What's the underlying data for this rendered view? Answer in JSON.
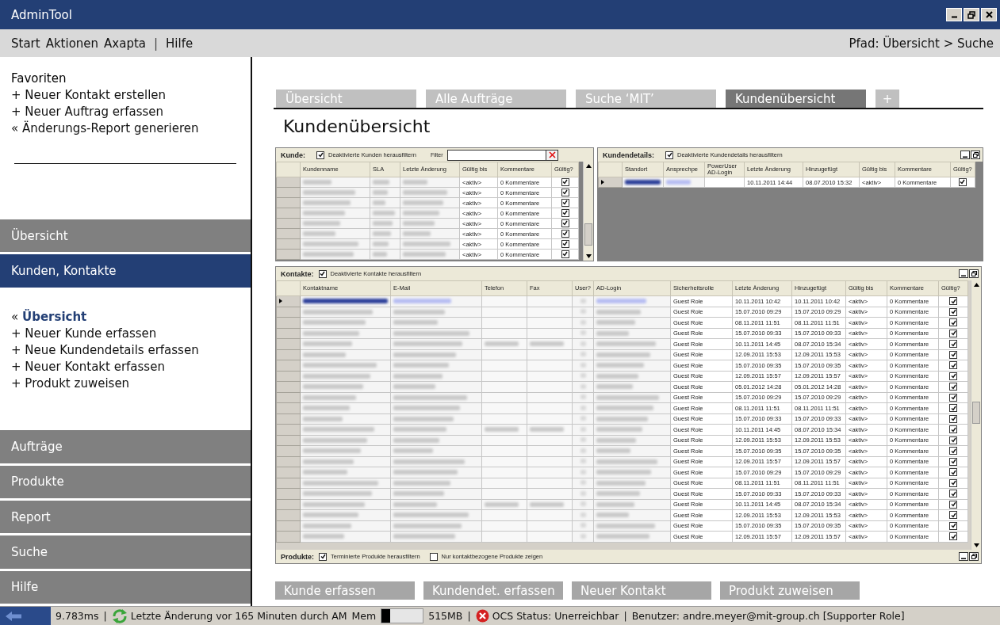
{
  "window": {
    "title": "AdminTool"
  },
  "menu": [
    {
      "kind": "item",
      "label": "Start"
    },
    {
      "kind": "item",
      "label": "Aktionen"
    },
    {
      "kind": "item",
      "label": "Axapta"
    },
    {
      "kind": "sep",
      "label": "|"
    },
    {
      "kind": "item",
      "label": "Hilfe"
    }
  ],
  "path": "Pfad: Übersicht > Suche",
  "favorites": {
    "title": "Favoriten",
    "links": [
      "+ Neuer Kontakt erstellen",
      "+ Neuer Auftrag erfassen",
      "« Änderungs-Report generieren"
    ]
  },
  "nav": [
    {
      "label": "Übersicht",
      "selected": false
    },
    {
      "label": "Kunden, Kontakte",
      "selected": true,
      "children": [
        {
          "prefix": "«",
          "label": "Übersicht",
          "selected": true
        },
        {
          "prefix": "+",
          "label": "Neuer Kunde erfassen",
          "selected": false
        },
        {
          "prefix": "+",
          "label": "Neue Kundendetails erfassen",
          "selected": false
        },
        {
          "prefix": "+",
          "label": "Neuer Kontakt erfassen",
          "selected": false
        },
        {
          "prefix": "+",
          "label": "Produkt zuweisen",
          "selected": false
        }
      ]
    },
    {
      "label": "Aufträge",
      "selected": false
    },
    {
      "label": "Produkte",
      "selected": false
    },
    {
      "label": "Report",
      "selected": false
    },
    {
      "label": "Suche",
      "selected": false
    },
    {
      "label": "Hilfe",
      "selected": false
    }
  ],
  "tabs": [
    {
      "kind": "tab",
      "label": "Übersicht",
      "selected": false
    },
    {
      "kind": "tab",
      "label": "Alle Aufträge",
      "selected": false
    },
    {
      "kind": "tab",
      "label": "Suche ‘MIT’",
      "selected": false
    },
    {
      "kind": "tab",
      "label": "Kundenübersicht",
      "selected": true
    },
    {
      "kind": "add",
      "label": "+",
      "selected": false
    }
  ],
  "heading": "Kundenübersicht",
  "customers": {
    "title": "Kunde:",
    "filter_toggle": {
      "label": "Deaktivierte Kunden herausfiltern",
      "checked": true
    },
    "filter_label": "Filter",
    "columns": [
      {
        "label": "Kundenname",
        "kind": "blur"
      },
      {
        "label": "SLA",
        "kind": "blur"
      },
      {
        "label": "Letzte Änderung",
        "kind": "blur"
      },
      {
        "label": "Gültig bis",
        "kind": "text"
      },
      {
        "label": "Kommentare",
        "kind": "text"
      },
      {
        "label": "Gültig?",
        "kind": "check"
      }
    ],
    "rows": [
      {
        "current": false,
        "values": [
          "<aktiv>",
          "0 Kommentare"
        ],
        "checked": true
      },
      {
        "current": false,
        "values": [
          "<aktiv>",
          "0 Kommentare"
        ],
        "checked": true
      },
      {
        "current": false,
        "values": [
          "<aktiv>",
          "0 Kommentare"
        ],
        "checked": true
      },
      {
        "current": false,
        "values": [
          "<aktiv>",
          "0 Kommentare"
        ],
        "checked": true
      },
      {
        "current": false,
        "values": [
          "<aktiv>",
          "0 Kommentare"
        ],
        "checked": true
      },
      {
        "current": false,
        "values": [
          "<aktiv>",
          "0 Kommentare"
        ],
        "checked": true
      },
      {
        "current": false,
        "values": [
          "<aktiv>",
          "0 Kommentare"
        ],
        "checked": true
      },
      {
        "current": false,
        "values": [
          "<aktiv>",
          "0 Kommentare"
        ],
        "checked": true
      }
    ]
  },
  "customer_details": {
    "title": "Kundendetails:",
    "filter_toggle": {
      "label": "Deaktivierte Kundendetails herausfiltern",
      "checked": true
    },
    "columns": [
      {
        "label": "Standort",
        "kind": "blur"
      },
      {
        "label": "Ansprechpe",
        "kind": "blur"
      },
      {
        "label": "PowerUser AD-Login",
        "kind": "empty"
      },
      {
        "label": "Letzte Änderung",
        "kind": "text"
      },
      {
        "label": "Hinzugefügt",
        "kind": "text"
      },
      {
        "label": "Gültig bis",
        "kind": "text"
      },
      {
        "label": "Kommentare",
        "kind": "text"
      },
      {
        "label": "Gültig?",
        "kind": "check"
      }
    ],
    "rows": [
      {
        "current": true,
        "values": [
          "10.11.2011 14:44",
          "08.07.2010 15:32",
          "<aktiv>",
          "0 Kommentare"
        ],
        "checked": true
      }
    ]
  },
  "contacts": {
    "title": "Kontakte:",
    "filter_toggle": {
      "label": "Deaktivierte Kontakte herausfiltern",
      "checked": true
    },
    "columns": [
      {
        "label": "Kontaktname",
        "kind": "blur"
      },
      {
        "label": "E-Mail",
        "kind": "blur"
      },
      {
        "label": "Telefon",
        "kind": "phone"
      },
      {
        "label": "Fax",
        "kind": "phone"
      },
      {
        "label": "User?",
        "kind": "blurcheck"
      },
      {
        "label": "AD-Login",
        "kind": "blur"
      },
      {
        "label": "Sicherheitsrolle",
        "kind": "text"
      },
      {
        "label": "Letzte Änderung",
        "kind": "text"
      },
      {
        "label": "Hinzugefügt",
        "kind": "text"
      },
      {
        "label": "Gültig bis",
        "kind": "text"
      },
      {
        "label": "Kommentare",
        "kind": "text"
      },
      {
        "label": "Gültig?",
        "kind": "check"
      }
    ],
    "rows": [
      {
        "current": true,
        "phone": false,
        "values": [
          "Guest Role",
          "10.11.2011 10:42",
          "10.11.2011 10:42",
          "<aktiv>",
          "0 Kommentare"
        ],
        "checked": true
      },
      {
        "current": false,
        "phone": false,
        "values": [
          "Guest Role",
          "15.07.2010 09:29",
          "15.07.2010 09:29",
          "<aktiv>",
          "0 Kommentare"
        ],
        "checked": true
      },
      {
        "current": false,
        "phone": false,
        "values": [
          "Guest Role",
          "08.11.2011 11:51",
          "08.11.2011 11:51",
          "<aktiv>",
          "0 Kommentare"
        ],
        "checked": true
      },
      {
        "current": false,
        "phone": false,
        "values": [
          "Guest Role",
          "15.07.2010 09:33",
          "15.07.2010 09:33",
          "<aktiv>",
          "0 Kommentare"
        ],
        "checked": true
      },
      {
        "current": false,
        "phone": true,
        "values": [
          "Guest Role",
          "10.11.2011 14:45",
          "08.07.2010 15:34",
          "<aktiv>",
          "0 Kommentare"
        ],
        "checked": true
      },
      {
        "current": false,
        "phone": false,
        "values": [
          "Guest Role",
          "12.09.2011 15:53",
          "12.09.2011 15:53",
          "<aktiv>",
          "0 Kommentare"
        ],
        "checked": true
      },
      {
        "current": false,
        "phone": false,
        "values": [
          "Guest Role",
          "15.07.2010 09:35",
          "15.07.2010 09:35",
          "<aktiv>",
          "0 Kommentare"
        ],
        "checked": true
      },
      {
        "current": false,
        "phone": false,
        "values": [
          "Guest Role",
          "12.09.2011 15:57",
          "12.09.2011 15:57",
          "<aktiv>",
          "0 Kommentare"
        ],
        "checked": true
      },
      {
        "current": false,
        "phone": false,
        "values": [
          "Guest Role",
          "05.01.2012 14:28",
          "05.01.2012 14:28",
          "<aktiv>",
          "0 Kommentare"
        ],
        "checked": true
      },
      {
        "current": false,
        "phone": false,
        "values": [
          "Guest Role",
          "15.07.2010 09:29",
          "15.07.2010 09:29",
          "<aktiv>",
          "0 Kommentare"
        ],
        "checked": true
      },
      {
        "current": false,
        "phone": false,
        "values": [
          "Guest Role",
          "08.11.2011 11:51",
          "08.11.2011 11:51",
          "<aktiv>",
          "0 Kommentare"
        ],
        "checked": true
      },
      {
        "current": false,
        "phone": false,
        "values": [
          "Guest Role",
          "15.07.2010 09:33",
          "15.07.2010 09:33",
          "<aktiv>",
          "0 Kommentare"
        ],
        "checked": true
      },
      {
        "current": false,
        "phone": true,
        "values": [
          "Guest Role",
          "10.11.2011 14:45",
          "08.07.2010 15:34",
          "<aktiv>",
          "0 Kommentare"
        ],
        "checked": true
      },
      {
        "current": false,
        "phone": false,
        "values": [
          "Guest Role",
          "12.09.2011 15:53",
          "12.09.2011 15:53",
          "<aktiv>",
          "0 Kommentare"
        ],
        "checked": true
      },
      {
        "current": false,
        "phone": false,
        "values": [
          "Guest Role",
          "15.07.2010 09:35",
          "15.07.2010 09:35",
          "<aktiv>",
          "0 Kommentare"
        ],
        "checked": true
      },
      {
        "current": false,
        "phone": false,
        "values": [
          "Guest Role",
          "12.09.2011 15:57",
          "12.09.2011 15:57",
          "<aktiv>",
          "0 Kommentare"
        ],
        "checked": true
      },
      {
        "current": false,
        "phone": false,
        "values": [
          "Guest Role",
          "15.07.2010 09:29",
          "15.07.2010 09:29",
          "<aktiv>",
          "0 Kommentare"
        ],
        "checked": true
      },
      {
        "current": false,
        "phone": false,
        "values": [
          "Guest Role",
          "08.11.2011 11:51",
          "08.11.2011 11:51",
          "<aktiv>",
          "0 Kommentare"
        ],
        "checked": true
      },
      {
        "current": false,
        "phone": false,
        "values": [
          "Guest Role",
          "15.07.2010 09:33",
          "15.07.2010 09:33",
          "<aktiv>",
          "0 Kommentare"
        ],
        "checked": true
      },
      {
        "current": false,
        "phone": true,
        "values": [
          "Guest Role",
          "10.11.2011 14:45",
          "08.07.2010 15:34",
          "<aktiv>",
          "0 Kommentare"
        ],
        "checked": true
      },
      {
        "current": false,
        "phone": false,
        "values": [
          "Guest Role",
          "12.09.2011 15:53",
          "12.09.2011 15:53",
          "<aktiv>",
          "0 Kommentare"
        ],
        "checked": true
      },
      {
        "current": false,
        "phone": false,
        "values": [
          "Guest Role",
          "15.07.2010 09:35",
          "15.07.2010 09:35",
          "<aktiv>",
          "0 Kommentare"
        ],
        "checked": true
      },
      {
        "current": false,
        "phone": false,
        "values": [
          "Guest Role",
          "12.09.2011 15:57",
          "12.09.2011 15:57",
          "<aktiv>",
          "0 Kommentare"
        ],
        "checked": true
      }
    ]
  },
  "products": {
    "title": "Produkte:",
    "options": [
      {
        "label": "Terminierte Produkte herausfiltern",
        "checked": true
      },
      {
        "label": "Nur kontaktbezogene Produkte zeigen",
        "checked": false
      }
    ]
  },
  "actions": [
    "Kunde erfassen",
    "Kundendet. erfassen",
    "Neuer Kontakt",
    "Produkt zuweisen"
  ],
  "status_bar": [
    {
      "kind": "back"
    },
    {
      "kind": "text",
      "text": "9.783ms"
    },
    {
      "kind": "sep",
      "text": "|"
    },
    {
      "kind": "refresh",
      "text": "Letzte Änderung vor 165 Minuten durch AM"
    },
    {
      "kind": "text",
      "text": "Mem"
    },
    {
      "kind": "meter",
      "level": 0.2
    },
    {
      "kind": "text",
      "text": "515MB"
    },
    {
      "kind": "sep",
      "text": "|"
    },
    {
      "kind": "error",
      "text": "OCS Status: Unerreichbar"
    },
    {
      "kind": "sep",
      "text": "|"
    },
    {
      "kind": "text",
      "text": "Benutzer: andre.meyer@mit-group.ch [Supporter Role]"
    }
  ]
}
